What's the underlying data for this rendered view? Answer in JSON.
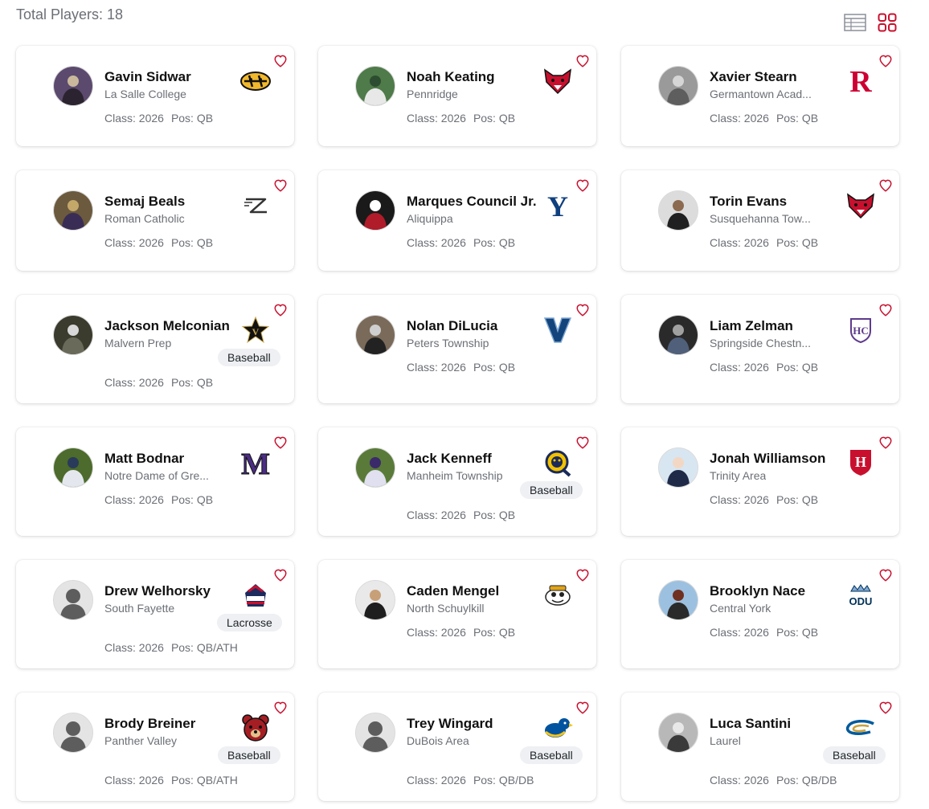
{
  "header": {
    "total_label": "Total Players: 18"
  },
  "colors": {
    "accent": "#c8102e",
    "icon_gray": "#8a8f98"
  },
  "players": [
    {
      "name": "Gavin Sidwar",
      "school": "La Salle College",
      "class_label": "Class: 2026",
      "pos_label": "Pos: QB",
      "sport": "",
      "logo": "mizzou-tiger-logo"
    },
    {
      "name": "Noah Keating",
      "school": "Pennridge",
      "class_label": "Class: 2026",
      "pos_label": "Pos: QB",
      "sport": "",
      "logo": "red-fox-logo"
    },
    {
      "name": "Xavier Stearn",
      "school": "Germantown Acad...",
      "class_label": "Class: 2026",
      "pos_label": "Pos: QB",
      "sport": "",
      "logo": "rutgers-r-logo"
    },
    {
      "name": "Semaj Beals",
      "school": "Roman Catholic",
      "class_label": "Class: 2026",
      "pos_label": "Pos: QB",
      "sport": "",
      "logo": "akron-z-logo"
    },
    {
      "name": "Marques Council Jr.",
      "school": "Aliquippa",
      "class_label": "Class: 2026",
      "pos_label": "Pos: QB",
      "sport": "",
      "logo": "yale-y-logo"
    },
    {
      "name": "Torin Evans",
      "school": "Susquehanna Tow...",
      "class_label": "Class: 2026",
      "pos_label": "Pos: QB",
      "sport": "",
      "logo": "red-fox-logo"
    },
    {
      "name": "Jackson Melconian",
      "school": "Malvern Prep",
      "class_label": "Class: 2026",
      "pos_label": "Pos: QB",
      "sport": "Baseball",
      "logo": "vanderbilt-star-logo"
    },
    {
      "name": "Nolan DiLucia",
      "school": "Peters Township",
      "class_label": "Class: 2026",
      "pos_label": "Pos: QB",
      "sport": "",
      "logo": "villanova-v-logo"
    },
    {
      "name": "Liam Zelman",
      "school": "Springside Chestn...",
      "class_label": "Class: 2026",
      "pos_label": "Pos: QB",
      "sport": "",
      "logo": "holy-cross-shield-logo"
    },
    {
      "name": "Matt Bodnar",
      "school": "Notre Dame of Gre...",
      "class_label": "Class: 2026",
      "pos_label": "Pos: QB",
      "sport": "",
      "logo": "purple-m-logo"
    },
    {
      "name": "Jack Kenneff",
      "school": "Manheim Township",
      "class_label": "Class: 2026",
      "pos_label": "Pos: QB",
      "sport": "Baseball",
      "logo": "bobcat-q-logo"
    },
    {
      "name": "Jonah Williamson",
      "school": "Trinity Area",
      "class_label": "Class: 2026",
      "pos_label": "Pos: QB",
      "sport": "",
      "logo": "harvard-h-shield-logo"
    },
    {
      "name": "Drew Welhorsky",
      "school": "South Fayette",
      "class_label": "Class: 2026",
      "pos_label": "Pos: QB/ATH",
      "sport": "Lacrosse",
      "logo": "colonials-logo"
    },
    {
      "name": "Caden Mengel",
      "school": "North Schuylkill",
      "class_label": "Class: 2026",
      "pos_label": "Pos: QB",
      "sport": "",
      "logo": "cartoon-mascot-logo"
    },
    {
      "name": "Brooklyn Nace",
      "school": "Central York",
      "class_label": "Class: 2026",
      "pos_label": "Pos: QB",
      "sport": "",
      "logo": "odu-crown-logo"
    },
    {
      "name": "Brody Breiner",
      "school": "Panther Valley",
      "class_label": "Class: 2026",
      "pos_label": "Pos: QB/ATH",
      "sport": "Baseball",
      "logo": "red-bear-logo"
    },
    {
      "name": "Trey Wingard",
      "school": "DuBois Area",
      "class_label": "Class: 2026",
      "pos_label": "Pos: QB/DB",
      "sport": "Baseball",
      "logo": "blue-hen-logo"
    },
    {
      "name": "Luca Santini",
      "school": "Laurel",
      "class_label": "Class: 2026",
      "pos_label": "Pos: QB/DB",
      "sport": "Baseball",
      "logo": "swoosh-c-logo"
    }
  ]
}
